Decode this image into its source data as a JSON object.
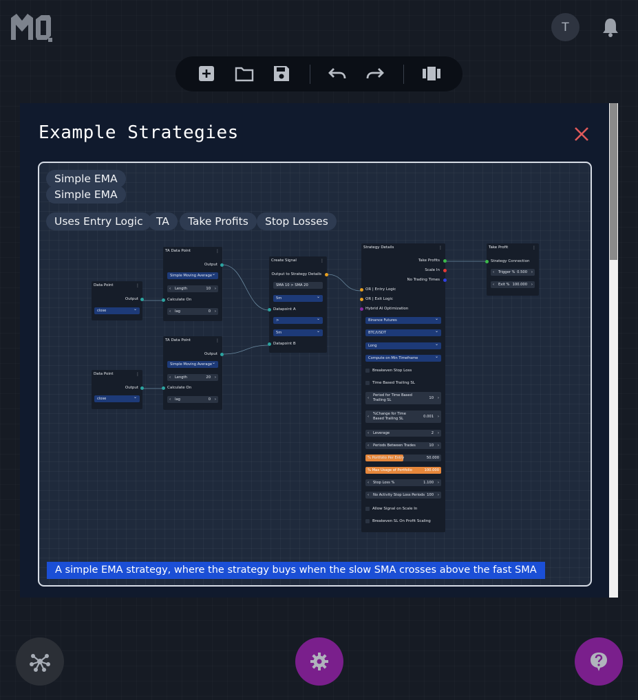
{
  "header": {
    "avatar_letter": "T",
    "logo_icon": "mo-logo",
    "notification_icon": "bell-icon"
  },
  "toolbar": {
    "icons": [
      "add-square-icon",
      "folder-icon",
      "save-icon",
      "undo-icon",
      "redo-icon",
      "columns-icon"
    ]
  },
  "modal": {
    "title": "Example Strategies",
    "close_icon": "close-icon",
    "close_color": "#e05a5a",
    "card": {
      "name": "Simple EMA",
      "subtitle": "Simple EMA",
      "tags": [
        "Uses Entry Logic",
        "TA",
        "Take Profits",
        "Stop Losses"
      ],
      "description": "A simple EMA strategy, where the strategy buys when the slow SMA crosses above the fast SMA",
      "nodes": {
        "dp1": {
          "title": "Data Point",
          "output": "Output",
          "source": "close"
        },
        "dp2": {
          "title": "Data Point",
          "output": "Output",
          "source": "close"
        },
        "ta1": {
          "title": "TA Data Point",
          "output": "Output",
          "indicator": "Simple Moving Average",
          "length_label": "Length",
          "length": "10",
          "calc": "Calculate On",
          "lag_label": "lag",
          "lag": "0"
        },
        "ta2": {
          "title": "TA Data Point",
          "output": "Output",
          "indicator": "Simple Moving Average",
          "length_label": "Length",
          "length": "20",
          "calc": "Calculate On",
          "lag_label": "lag",
          "lag": "0"
        },
        "signal": {
          "title": "Create Signal",
          "output": "Output to Strategy Details",
          "expr": "SMA 10 > SMA 20",
          "tf1": "5m",
          "dp_a": "Datapoint A",
          "op": ">",
          "tf2": "5m",
          "dp_b": "Datapoint B"
        },
        "strategy": {
          "title": "Strategy Details",
          "take_profits": "Take Profits",
          "scale_in": "Scale In",
          "no_trading": "No Trading Times",
          "entry": "OR | Entry Logic",
          "exit": "OR | Exit Logic",
          "hybrid": "Hybrid AI Optimization",
          "exchange": "Binance Futures",
          "pair": "BTC/USDT",
          "side": "Long",
          "compute": "Compute on Min Timeframe",
          "breakeven": "Breakeven Stop Loss",
          "time_trailing": "Time Based Trailing SL",
          "period_label": "Period for Time Based Trailing SL",
          "period": "10",
          "pct_change_label": "%Change for Time Based Trailing SL",
          "pct_change": "0.001",
          "leverage_label": "Leverage",
          "leverage": "2",
          "periods_between_label": "Periods Between Trades",
          "periods_between": "10",
          "portfolio_entry_label": "% Portfolio Per Entry",
          "portfolio_entry": "50.000",
          "max_usage_label": "% Max Usage of Portfolio",
          "max_usage": "100.000",
          "stop_loss_label": "Stop Loss %",
          "stop_loss": "1.100",
          "no_activity_label": "No Activity Stop Loss Periods",
          "no_activity": "100",
          "allow_signal": "Allow Signal on Scale In",
          "breakeven_scaling": "Breakeven SL On Profit Scaling"
        },
        "tp": {
          "title": "Take Profit",
          "connection": "Strategy Connection",
          "trigger_label": "Trigger %",
          "trigger": "0.500",
          "exit_label": "Exit %",
          "exit": "100.000"
        }
      }
    }
  },
  "footer": {
    "left_icon": "network-icon",
    "center_icon": "gear-icon",
    "right_icon": "help-icon",
    "accent": "#7a1f8c"
  }
}
